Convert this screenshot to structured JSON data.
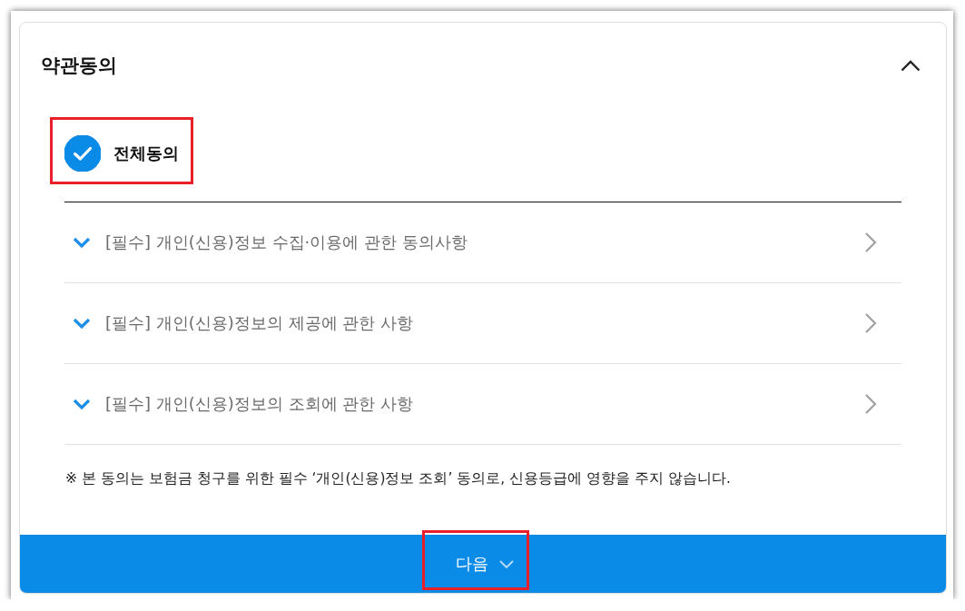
{
  "section": {
    "title": "약관동의",
    "expanded": true
  },
  "agree_all": {
    "label": "전체동의",
    "checked": true,
    "highlighted": true
  },
  "terms": [
    {
      "label": "[필수] 개인(신용)정보 수집·이용에 관한 동의사항",
      "checked": true
    },
    {
      "label": "[필수] 개인(신용)정보의 제공에 관한 사항",
      "checked": true
    },
    {
      "label": "[필수] 개인(신용)정보의 조회에 관한 사항",
      "checked": true
    }
  ],
  "notice": "※ 본 동의는 보험금 청구를 위한 필수 ‘개인(신용)정보 조회’ 동의로, 신용등급에 영향을 주지 않습니다.",
  "next_button": {
    "label": "다음",
    "highlighted": true
  }
}
